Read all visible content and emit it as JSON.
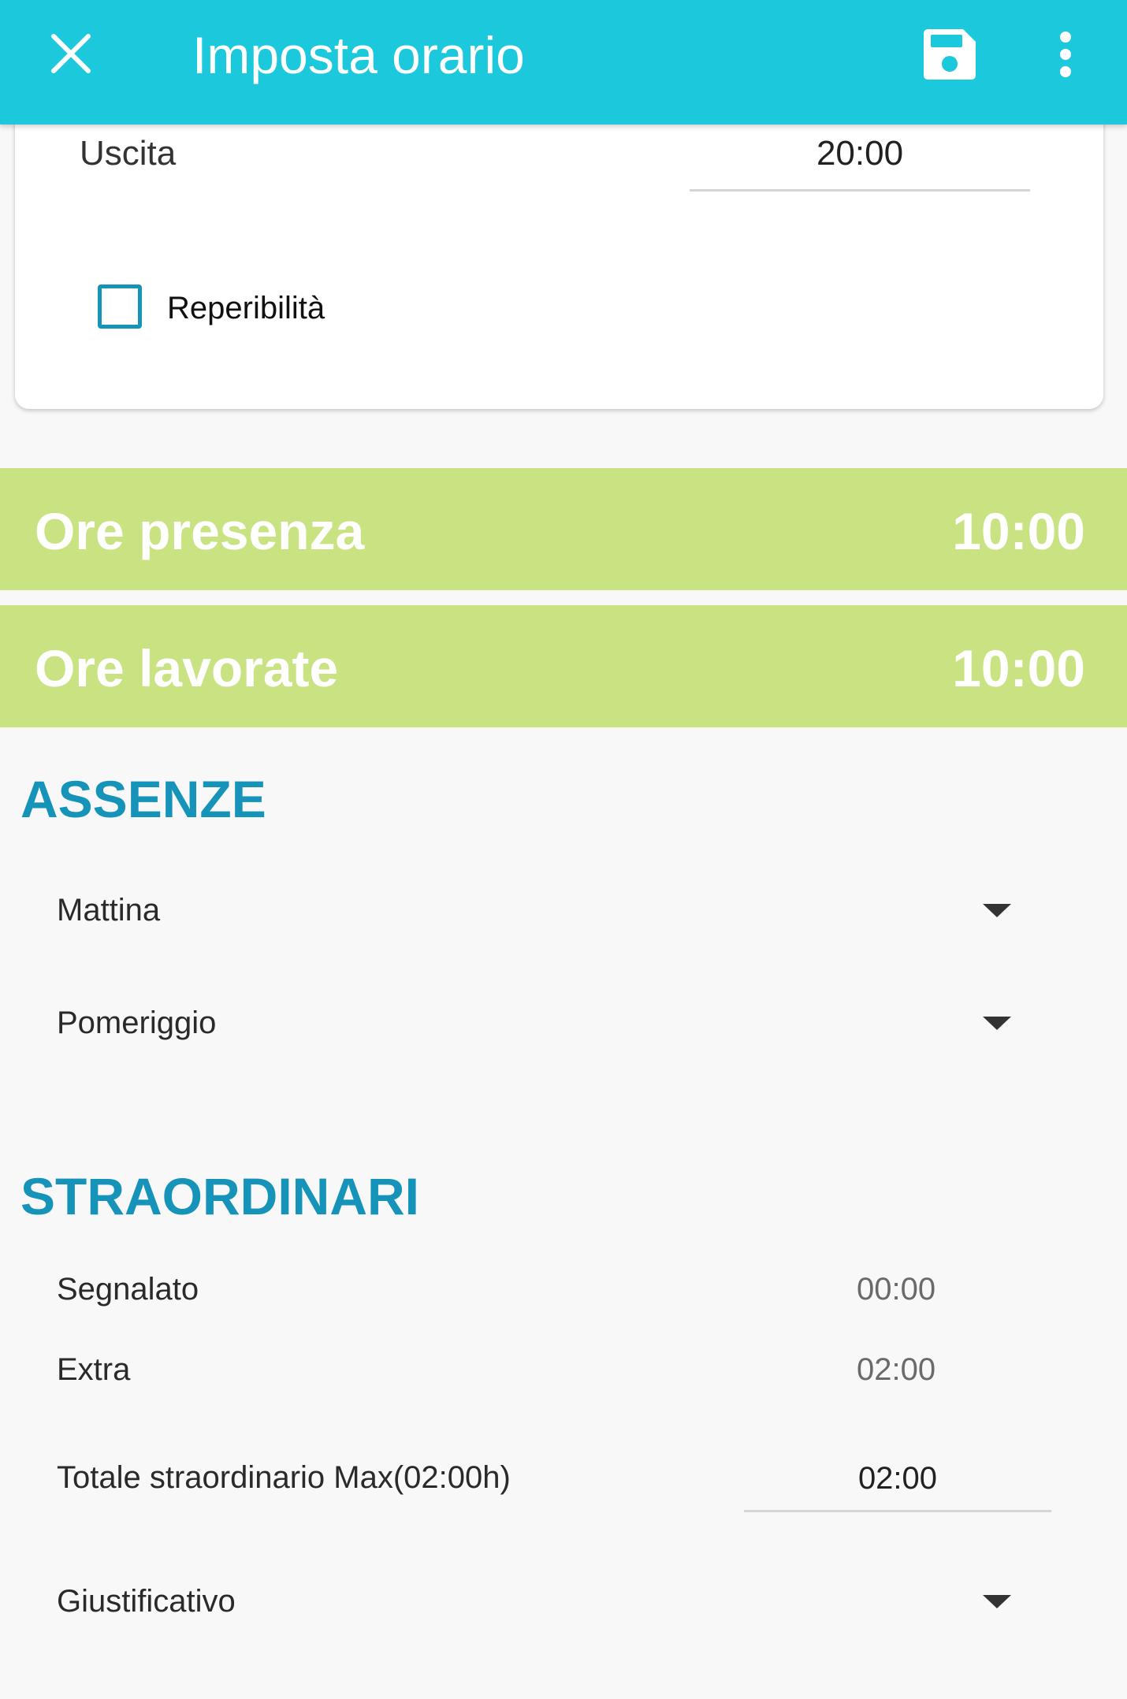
{
  "appbar": {
    "title": "Imposta orario",
    "close_icon": "close-icon",
    "save_icon": "save-icon",
    "menu_icon": "more-vert-icon",
    "background": "#1bc8dc"
  },
  "card": {
    "uscita_label": "Uscita",
    "uscita_value": "20:00",
    "reperibilita_label": "Reperibilità",
    "reperibilita_checked": false
  },
  "summary": {
    "presenza_label": "Ore presenza",
    "presenza_value": "10:00",
    "lavorate_label": "Ore lavorate",
    "lavorate_value": "10:00",
    "background": "#c9e383"
  },
  "assenze": {
    "title": "ASSENZE",
    "mattina_label": "Mattina",
    "pomeriggio_label": "Pomeriggio"
  },
  "straordinari": {
    "title": "STRAORDINARI",
    "segnalato_label": "Segnalato",
    "segnalato_value": "00:00",
    "extra_label": "Extra",
    "extra_value": "02:00",
    "totale_label": "Totale straordinario Max(02:00h)",
    "totale_value": "02:00",
    "giustificativo_label": "Giustificativo"
  },
  "colors": {
    "accent": "#1593b8",
    "page_background": "#f8f8f8"
  }
}
